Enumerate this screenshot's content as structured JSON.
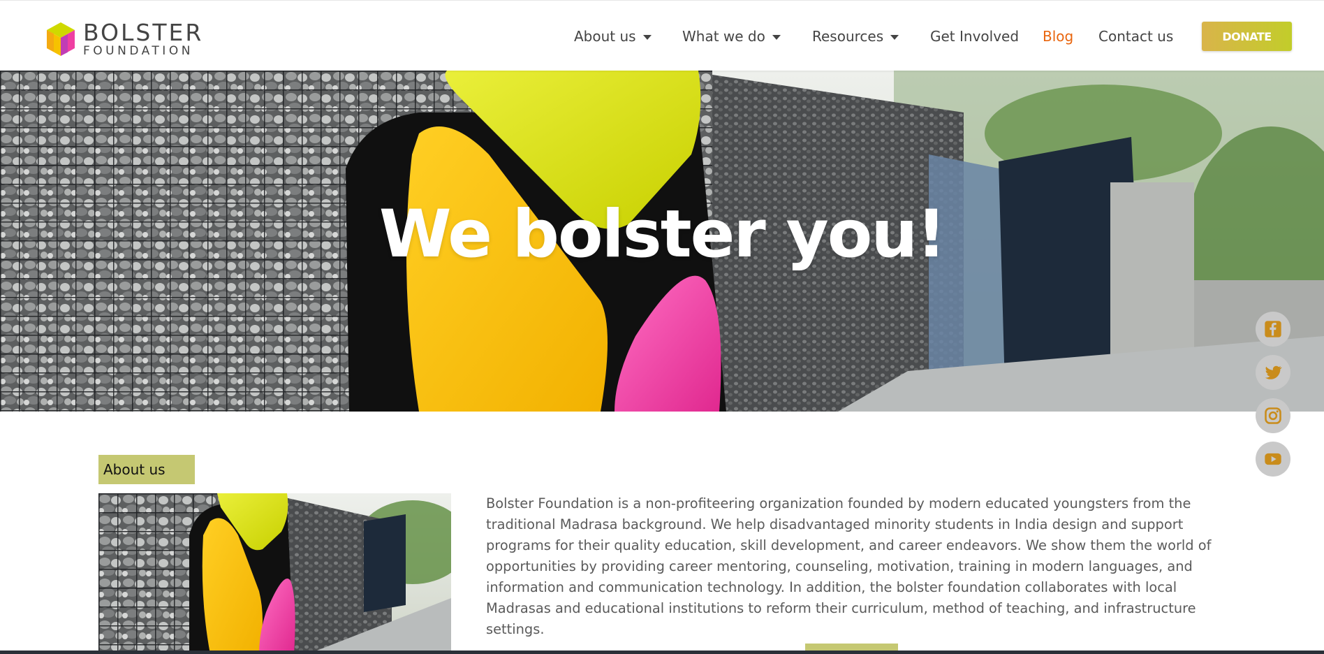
{
  "brand": {
    "name_line1": "BOLSTER",
    "name_line2": "FOUNDATION",
    "colors": {
      "yellow": "#f6c200",
      "lime": "#cfd900",
      "pink": "#ef3fa2",
      "accent_orange": "#e9650d"
    }
  },
  "nav": {
    "items": [
      {
        "label": "About us",
        "dropdown": true
      },
      {
        "label": "What we do",
        "dropdown": true
      },
      {
        "label": "Resources",
        "dropdown": true
      },
      {
        "label": "Get Involved",
        "dropdown": false
      },
      {
        "label": "Blog",
        "dropdown": false,
        "active": true
      },
      {
        "label": "Contact us",
        "dropdown": false
      }
    ],
    "donate_label": "DONATE"
  },
  "hero": {
    "title": "We bolster you!"
  },
  "social": [
    {
      "icon": "facebook-icon"
    },
    {
      "icon": "twitter-icon"
    },
    {
      "icon": "instagram-icon"
    },
    {
      "icon": "youtube-icon"
    }
  ],
  "about": {
    "label": "About us",
    "text": "Bolster Foundation is a non-profiteering organization founded by modern educated youngsters from the traditional Madrasa background. We help disadvantaged minority students in India design and support programs for their quality education, skill development, and career endeavors. We show them the world of opportunities by providing career mentoring, counseling, motivation, training in modern languages, and information and communication technology. In addition, the bolster foundation collaborates with local Madrasas and educational institutions to reform their curriculum, method of teaching, and infrastructure settings."
  }
}
